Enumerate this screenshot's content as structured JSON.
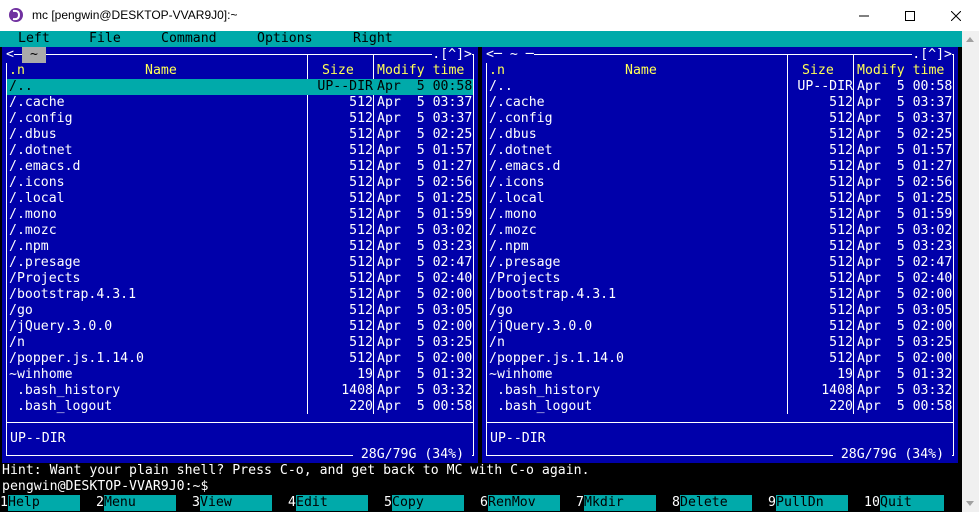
{
  "window": {
    "title": "mc [pengwin@DESKTOP-VVAR9J0]:~"
  },
  "menu": [
    "Left",
    "File",
    "Command",
    "Options",
    "Right"
  ],
  "panels": {
    "left": {
      "tab": "~",
      "dir_label": "",
      "corner": ".[^]>",
      "left_marker": "<",
      "status": "UP--DIR",
      "disk": "28G/79G (34%)"
    },
    "right": {
      "tab": "",
      "dir_label": "<─ ~ ─",
      "corner": ".[^]>",
      "left_marker": "",
      "status": "UP--DIR",
      "disk": "28G/79G (34%)"
    }
  },
  "columns": {
    "sort": ".n",
    "name": "Name",
    "size": "Size",
    "modify": "Modify time"
  },
  "files": [
    {
      "name": "/..",
      "size": "UP--DIR",
      "time": "Apr  5 00:58"
    },
    {
      "name": "/.cache",
      "size": "512",
      "time": "Apr  5 03:37"
    },
    {
      "name": "/.config",
      "size": "512",
      "time": "Apr  5 03:37"
    },
    {
      "name": "/.dbus",
      "size": "512",
      "time": "Apr  5 02:25"
    },
    {
      "name": "/.dotnet",
      "size": "512",
      "time": "Apr  5 01:57"
    },
    {
      "name": "/.emacs.d",
      "size": "512",
      "time": "Apr  5 01:27"
    },
    {
      "name": "/.icons",
      "size": "512",
      "time": "Apr  5 02:56"
    },
    {
      "name": "/.local",
      "size": "512",
      "time": "Apr  5 01:25"
    },
    {
      "name": "/.mono",
      "size": "512",
      "time": "Apr  5 01:59"
    },
    {
      "name": "/.mozc",
      "size": "512",
      "time": "Apr  5 03:02"
    },
    {
      "name": "/.npm",
      "size": "512",
      "time": "Apr  5 03:23"
    },
    {
      "name": "/.presage",
      "size": "512",
      "time": "Apr  5 02:47"
    },
    {
      "name": "/Projects",
      "size": "512",
      "time": "Apr  5 02:40"
    },
    {
      "name": "/bootstrap.4.3.1",
      "size": "512",
      "time": "Apr  5 02:00"
    },
    {
      "name": "/go",
      "size": "512",
      "time": "Apr  5 03:05"
    },
    {
      "name": "/jQuery.3.0.0",
      "size": "512",
      "time": "Apr  5 02:00"
    },
    {
      "name": "/n",
      "size": "512",
      "time": "Apr  5 03:25"
    },
    {
      "name": "/popper.js.1.14.0",
      "size": "512",
      "time": "Apr  5 02:00"
    },
    {
      "name": "~winhome",
      "size": "19",
      "time": "Apr  5 01:32"
    },
    {
      "name": " .bash_history",
      "size": "1408",
      "time": "Apr  5 03:32"
    },
    {
      "name": " .bash_logout",
      "size": "220",
      "time": "Apr  5 00:58"
    }
  ],
  "hint": "Hint: Want your plain shell? Press C-o, and get back to MC with C-o again.",
  "prompt": "pengwin@DESKTOP-VVAR9J0:~$",
  "fkeys": [
    {
      "num": "1",
      "label": "Help"
    },
    {
      "num": "2",
      "label": "Menu"
    },
    {
      "num": "3",
      "label": "View"
    },
    {
      "num": "4",
      "label": "Edit"
    },
    {
      "num": "5",
      "label": "Copy"
    },
    {
      "num": "6",
      "label": "RenMov"
    },
    {
      "num": "7",
      "label": "Mkdir"
    },
    {
      "num": "8",
      "label": "Delete"
    },
    {
      "num": "9",
      "label": "PullDn"
    },
    {
      "num": "10",
      "label": "Quit"
    }
  ],
  "colors": {
    "panel": "#0000aa",
    "menu": "#00aaaa",
    "header": "#ffff55",
    "selection": "#00aaaa"
  }
}
